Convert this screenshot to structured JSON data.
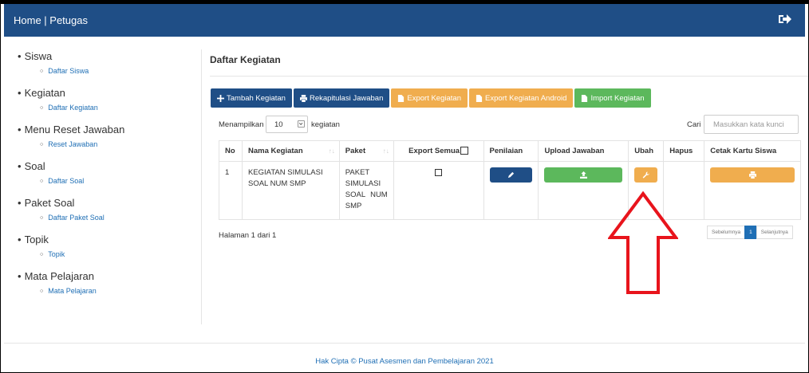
{
  "navbar": {
    "brand": "Home | Petugas",
    "logout_icon": "sign-out-icon"
  },
  "sidebar": [
    {
      "label": "Siswa",
      "sub": "Daftar Siswa"
    },
    {
      "label": "Kegiatan",
      "sub": "Daftar Kegiatan"
    },
    {
      "label": "Menu Reset Jawaban",
      "sub": "Reset Jawaban"
    },
    {
      "label": "Soal",
      "sub": "Daftar Soal"
    },
    {
      "label": "Paket Soal",
      "sub": "Daftar Paket Soal"
    },
    {
      "label": "Topik",
      "sub": "Topik"
    },
    {
      "label": "Mata Pelajaran",
      "sub": "Mata Pelajaran"
    }
  ],
  "main": {
    "title": "Daftar Kegiatan"
  },
  "toolbar": {
    "tambah": "Tambah Kegiatan",
    "rekap": "Rekapitulasi Jawaban",
    "export": "Export Kegiatan",
    "export_android": "Export Kegiatan Android",
    "import": "Import Kegiatan"
  },
  "table_controls": {
    "length_label": "Menampilkan",
    "length_value": "10",
    "length_suffix": "kegiatan",
    "search_label": "Cari",
    "search_placeholder": "Masukkan kata kunci"
  },
  "table": {
    "headers": {
      "no": "No",
      "nama": "Nama Kegiatan",
      "paket": "Paket",
      "export": "Export Semua",
      "penilaian": "Penilaian",
      "upload": "Upload Jawaban",
      "ubah": "Ubah",
      "hapus": "Hapus",
      "cetak": "Cetak Kartu Siswa"
    },
    "rows": [
      {
        "no": "1",
        "nama": "KEGIATAN SIMULASI SOAL NUM SMP",
        "paket": "PAKET SIMULASI SOAL NUM SMP"
      }
    ]
  },
  "pagination": {
    "info": "Halaman 1 dari 1",
    "prev": "Sebelumnya",
    "current": "1",
    "next": "Selanjutnya"
  },
  "footer": {
    "text": "Hak Cipta © Pusat Asesmen dan Pembelajaran 2021"
  },
  "colors": {
    "primary": "#1f4e86",
    "warning": "#f0ad4e",
    "success": "#5cb85c",
    "link": "#1f6fb5",
    "annotation": "#e8141c"
  }
}
